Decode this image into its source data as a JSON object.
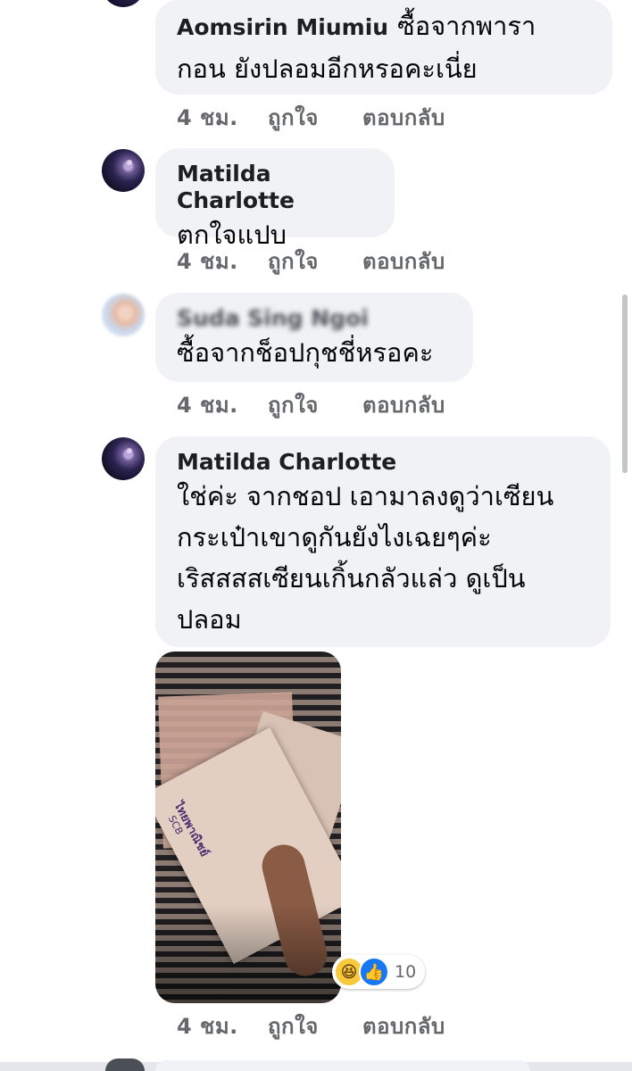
{
  "comments": [
    {
      "name": "Aomsirin Miumiu",
      "text_line1": "ซื้อจากพารา",
      "text_line2": "กอน ยังปลอมอีกหรอคะเนี่ย",
      "time": "4 ชม.",
      "like": "ถูกใจ",
      "reply": "ตอบกลับ"
    },
    {
      "name": "Matilda Charlotte",
      "text": "ตกใจแปบ",
      "time": "4 ชม.",
      "like": "ถูกใจ",
      "reply": "ตอบกลับ"
    },
    {
      "name": "Suda Sing Ngoi",
      "text": "ซื้อจากช็อปกุชชี่หรอคะ",
      "time": "4 ชม.",
      "like": "ถูกใจ",
      "reply": "ตอบกลับ"
    },
    {
      "name": "Matilda Charlotte",
      "lines": [
        "ใช่ค่ะ จากชอป เอามาลงดูว่าเซียน",
        "กระเป๋าเขาดูกันยังไงเฉยๆค่ะ",
        "เริสสสสเซียนเกิ้นกลัวแล่ว ดูเป็น",
        "ปลอม"
      ],
      "time": "4 ชม.",
      "like": "ถูกใจ",
      "reply": "ตอบกลับ",
      "reactions": {
        "icons": [
          "haha-icon",
          "like-icon"
        ],
        "count": "10"
      }
    }
  ],
  "photo_receipt_text": {
    "bank": "ไทยพาณิชย์",
    "bank_abbr": "SCB"
  },
  "colors": {
    "bubble": "#f0f2f5",
    "meta": "#65676b",
    "like_blue": "#1877f2"
  }
}
